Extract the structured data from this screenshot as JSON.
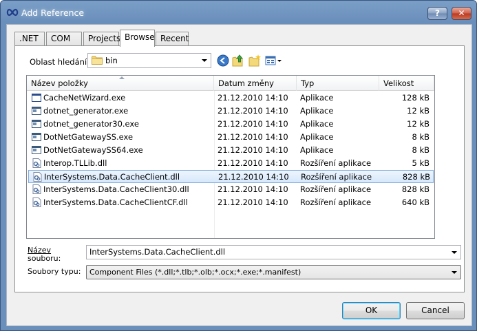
{
  "window": {
    "title": "Add Reference",
    "help_label": "?",
    "close_label": "✕"
  },
  "tabs": [
    {
      "label": ".NET"
    },
    {
      "label": "COM"
    },
    {
      "label": "Projects"
    },
    {
      "label": "Browse",
      "active": true
    },
    {
      "label": "Recent"
    }
  ],
  "lookin": {
    "label": "Oblast hledání:",
    "value": "bin"
  },
  "list": {
    "columns": [
      "Název položky",
      "Datum změny",
      "Typ",
      "Velikost"
    ],
    "rows": [
      {
        "icon": "window-app-icon",
        "name": "CacheNetWizard.exe",
        "date": "21.12.2010 14:10",
        "type": "Aplikace",
        "size": "128 kB"
      },
      {
        "icon": "console-app-icon",
        "name": "dotnet_generator.exe",
        "date": "21.12.2010 14:10",
        "type": "Aplikace",
        "size": "12 kB"
      },
      {
        "icon": "console-app-icon",
        "name": "dotnet_generator30.exe",
        "date": "21.12.2010 14:10",
        "type": "Aplikace",
        "size": "12 kB"
      },
      {
        "icon": "console-app-icon",
        "name": "DotNetGatewaySS.exe",
        "date": "21.12.2010 14:10",
        "type": "Aplikace",
        "size": "8 kB"
      },
      {
        "icon": "console-app-icon",
        "name": "DotNetGatewaySS64.exe",
        "date": "21.12.2010 14:10",
        "type": "Aplikace",
        "size": "8 kB"
      },
      {
        "icon": "dll-icon",
        "name": "Interop.TLLib.dll",
        "date": "21.12.2010 14:10",
        "type": "Rozšíření aplikace",
        "size": "5 kB"
      },
      {
        "icon": "dll-icon",
        "name": "InterSystems.Data.CacheClient.dll",
        "date": "21.12.2010 14:10",
        "type": "Rozšíření aplikace",
        "size": "828 kB",
        "selected": true
      },
      {
        "icon": "dll-icon",
        "name": "InterSystems.Data.CacheClient30.dll",
        "date": "21.12.2010 14:10",
        "type": "Rozšíření aplikace",
        "size": "828 kB"
      },
      {
        "icon": "dll-icon",
        "name": "InterSystems.Data.CacheClientCF.dll",
        "date": "21.12.2010 14:10",
        "type": "Rozšíření aplikace",
        "size": "640 kB"
      }
    ]
  },
  "filename": {
    "label_line1": "Název",
    "label_line2": "souboru:",
    "value": "InterSystems.Data.CacheClient.dll"
  },
  "filetype": {
    "label": "Soubory typu:",
    "value": "Component Files (*.dll;*.tlb;*.olb;*.ocx;*.exe;*.manifest)"
  },
  "buttons": {
    "ok": "OK",
    "cancel": "Cancel"
  },
  "colors": {
    "titlebar": "#6b8fbb",
    "selection_border": "#84acdd",
    "selection_fill": "#d6e8fc"
  }
}
